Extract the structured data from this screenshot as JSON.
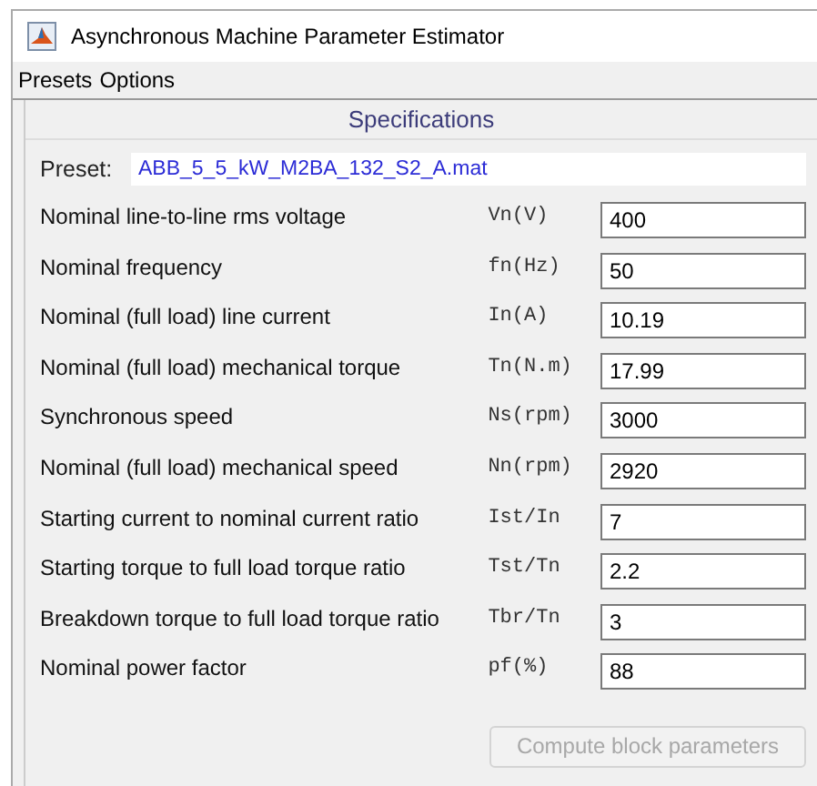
{
  "window": {
    "title": "Asynchronous Machine Parameter Estimator"
  },
  "menu": [
    "Presets",
    "Options"
  ],
  "panel": {
    "title": "Specifications",
    "preset": {
      "label": "Preset:",
      "value": "ABB_5_5_kW_M2BA_132_S2_A.mat"
    },
    "fields": [
      {
        "label": "Nominal line-to-line rms voltage",
        "symbol": "Vn(V)",
        "value": "400"
      },
      {
        "label": "Nominal frequency",
        "symbol": "fn(Hz)",
        "value": "50"
      },
      {
        "label": "Nominal (full load) line current",
        "symbol": "In(A)",
        "value": "10.19"
      },
      {
        "label": "Nominal (full load) mechanical torque",
        "symbol": "Tn(N.m)",
        "value": "17.99"
      },
      {
        "label": "Synchronous speed",
        "symbol": "Ns(rpm)",
        "value": "3000"
      },
      {
        "label": "Nominal (full load) mechanical speed",
        "symbol": "Nn(rpm)",
        "value": "2920"
      },
      {
        "label": "Starting current to nominal current ratio",
        "symbol": "Ist/In",
        "value": "7"
      },
      {
        "label": "Starting torque to full load torque ratio",
        "symbol": "Tst/Tn",
        "value": "2.2"
      },
      {
        "label": "Breakdown torque to full load torque ratio",
        "symbol": "Tbr/Tn",
        "value": "3"
      },
      {
        "label": "Nominal power factor",
        "symbol": "pf(%)",
        "value": "88"
      }
    ],
    "button": {
      "label": "Compute block parameters",
      "disabled": true
    }
  }
}
